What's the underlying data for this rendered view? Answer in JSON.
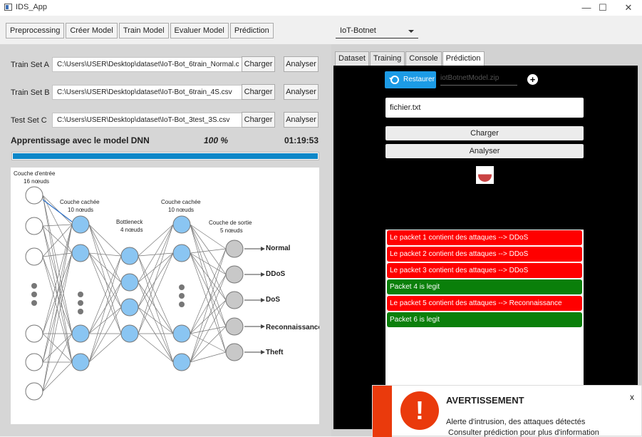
{
  "window": {
    "title": "IDS_App",
    "minimize": "—",
    "maximize": "☐",
    "close": "✕"
  },
  "menu": [
    "Preprocessing",
    "Créer Model",
    "Train Model",
    "Evaluer Model",
    "Prédiction"
  ],
  "dataset_combo": {
    "value": "IoT-Botnet"
  },
  "left": {
    "rows": [
      {
        "label": "Train Set A",
        "path": "C:\\Users\\USER\\Desktop\\dataset\\IoT-Bot_6train_Normal.c",
        "load": "Charger",
        "analyze": "Analyser"
      },
      {
        "label": "Train Set B",
        "path": "C:\\Users\\USER\\Desktop\\dataset\\IoT-Bot_6train_4S.csv",
        "load": "Charger",
        "analyze": "Analyser"
      },
      {
        "label": "Test Set  C",
        "path": "C:\\Users\\USER\\Desktop\\dataset\\IoT-Bot_3test_3S.csv",
        "load": "Charger",
        "analyze": "Analyser"
      }
    ],
    "learning": {
      "label": "Apprentissage avec le model DNN",
      "percent": "100 %",
      "time": "01:19:53",
      "progress": 1.0
    },
    "diagram": {
      "input_title": "Couche d'entrée",
      "input_nodes": "16 nœuds",
      "hidden1_title": "Couche cachée",
      "hidden1_nodes": "10 nœuds",
      "bottleneck_title": "Bottleneck",
      "bottleneck_nodes": "4 nœuds",
      "hidden2_title": "Couche cachée",
      "hidden2_nodes": "10 nœuds",
      "output_title": "Couche de sortie",
      "output_nodes": "5 nœuds",
      "outputs": [
        "Normal",
        "DDoS",
        "DoS",
        "Reconnaissance",
        "Theft"
      ]
    }
  },
  "right": {
    "tabs": [
      "Dataset",
      "Training",
      "Console",
      "Prédiction"
    ],
    "active_tab": "Prédiction",
    "restore_label": "Restaurer",
    "model_file": "iotBotnetModel.zip",
    "file_field": "fichier.txt",
    "load_button": "Charger",
    "analyze_button": "Analyser",
    "packets": [
      {
        "text": "Le packet 1 contient des attaques --> DDoS",
        "status": "attack"
      },
      {
        "text": "Le packet 2 contient des attaques --> DDoS",
        "status": "attack"
      },
      {
        "text": "Le packet 3 contient des attaques --> DDoS",
        "status": "attack"
      },
      {
        "text": "Packet 4 is legit",
        "status": "legit"
      },
      {
        "text": "Le packet 5 contient des attaques --> Reconnaissance",
        "status": "attack"
      },
      {
        "text": "Packet 6 is legit",
        "status": "legit"
      }
    ],
    "colors": {
      "attack": "#ff0000",
      "legit": "#0a7f0a",
      "accent": "#1c9be6"
    }
  },
  "alert": {
    "title": "AVERTISSEMENT",
    "close": "x",
    "line1": "Alerte d'intrusion, des attaques détectés",
    "line2": "Consulter prédiction pour plus d'information"
  }
}
